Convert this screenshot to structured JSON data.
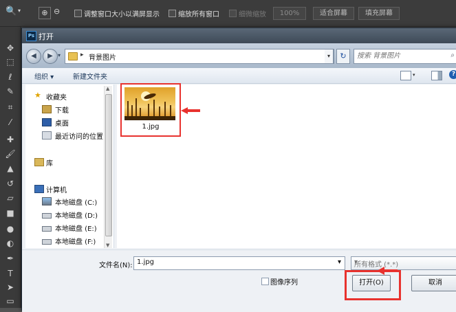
{
  "photoshop": {
    "options_bar": {
      "resize_windows_label": "调整窗口大小以满屏显示",
      "zoom_all_windows_label": "缩放所有窗口",
      "scrubby_zoom_label": "细微缩放",
      "zoom_percent": "100%",
      "fit_screen_label": "适合屏幕",
      "fill_screen_label": "填充屏幕"
    }
  },
  "dialog": {
    "title": "打开",
    "address": {
      "path": [
        "背景图片"
      ]
    },
    "search": {
      "placeholder": "搜索 背景图片"
    },
    "toolbar": {
      "organize_label": "组织 ▾",
      "new_folder_label": "新建文件夹"
    },
    "nav": {
      "favorites_label": "收藏夹",
      "favorites": [
        {
          "label": "下载",
          "icon": "download-icon"
        },
        {
          "label": "桌面",
          "icon": "desktop-icon"
        },
        {
          "label": "最近访问的位置",
          "icon": "recent-places-icon"
        }
      ],
      "libraries_label": "库",
      "computer_label": "计算机",
      "drives": [
        {
          "label": "本地磁盘 (C:)",
          "icon": "drive-icon"
        },
        {
          "label": "本地磁盘 (D:)",
          "icon": "drive-icon"
        },
        {
          "label": "本地磁盘 (E:)",
          "icon": "drive-icon"
        },
        {
          "label": "本地磁盘 (F:)",
          "icon": "drive-icon"
        }
      ]
    },
    "files": [
      {
        "name": "1.jpg",
        "selected": true
      }
    ],
    "filename_label": "文件名(N):",
    "filename_value": "1.jpg",
    "filetype_value": "所有格式 (*.*)",
    "image_sequence_label": "图像序列",
    "open_button": "打开(O)",
    "cancel_button": "取消"
  },
  "colors": {
    "highlight": "#e8322e",
    "dialog_bg": "#eef1f5",
    "titlebar": "#4b5866",
    "ps_dark": "#3c3c3c"
  }
}
